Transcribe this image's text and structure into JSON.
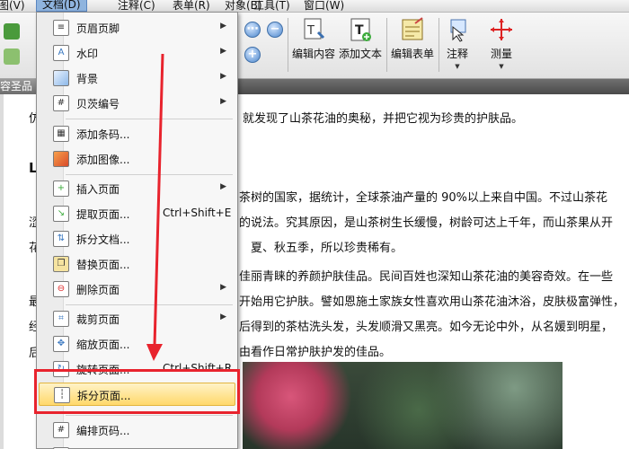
{
  "menubar": {
    "items": [
      "图(V)",
      "文档(D)",
      "注释(C)",
      "表单(R)",
      "对象(B)",
      "工具(T)",
      "窗口(W)"
    ]
  },
  "toolbar": {
    "edit_content": "编辑内容",
    "add_text": "添加文本",
    "edit_form": "编辑表单",
    "comment": "注释",
    "measure": "测量"
  },
  "tab": {
    "label": "容圣品"
  },
  "document": {
    "lines": [
      "就发现了山茶花油的奥秘，并把它视为珍贵的护肤品。",
      "茶树的国家，据统计，全球茶油产量的 90%以上来自中国。不过山茶花",
      "的说法。究其原因，是山茶树生长缓慢，树龄可达上千年，而山茶果从开",
      "夏、秋五季，所以珍贵稀有。",
      "佳丽青睐的养颜护肤佳品。民间百姓也深知山茶花油的美容奇效。在一些",
      "开始用它护肤。譬如恩施土家族女性喜欢用山茶花油沐浴，皮肤极富弹性，",
      "后得到的茶枯洗头发，头发顺滑又黑亮。如今无论中外，从名媛到明星，",
      "由看作日常护肤护发的佳品。"
    ],
    "left_fragments": [
      "仿",
      "L",
      "涩",
      "花",
      "最",
      "经",
      "后"
    ]
  },
  "doc_menu": {
    "items": [
      {
        "label": "页眉页脚",
        "submenu": true,
        "icon": "header-footer-icon"
      },
      {
        "label": "水印",
        "submenu": true,
        "icon": "watermark-icon"
      },
      {
        "label": "背景",
        "submenu": true,
        "icon": "background-icon"
      },
      {
        "label": "贝茨编号",
        "submenu": true,
        "icon": "bates-number-icon"
      },
      {
        "label": "添加条码...",
        "icon": "barcode-icon"
      },
      {
        "label": "添加图像...",
        "icon": "add-image-icon"
      },
      {
        "label": "插入页面",
        "submenu": true,
        "icon": "insert-page-icon"
      },
      {
        "label": "提取页面...",
        "shortcut": "Ctrl+Shift+E",
        "icon": "extract-page-icon"
      },
      {
        "label": "拆分文档...",
        "icon": "split-document-icon"
      },
      {
        "label": "替换页面...",
        "icon": "replace-page-icon"
      },
      {
        "label": "删除页面",
        "submenu": true,
        "icon": "delete-page-icon"
      },
      {
        "label": "裁剪页面",
        "submenu": true,
        "icon": "crop-page-icon"
      },
      {
        "label": "缩放页面...",
        "icon": "resize-page-icon"
      },
      {
        "label": "旋转页面...",
        "shortcut": "Ctrl+Shift+R",
        "icon": "rotate-page-icon"
      },
      {
        "label": "拆分页面...",
        "icon": "split-page-icon",
        "highlighted": true
      },
      {
        "label": "编排页码...",
        "icon": "number-pages-icon"
      }
    ]
  },
  "colors": {
    "highlight_box": "#e8232d",
    "arrow": "#e8232d",
    "menu_highlight": "#ffd86a"
  }
}
